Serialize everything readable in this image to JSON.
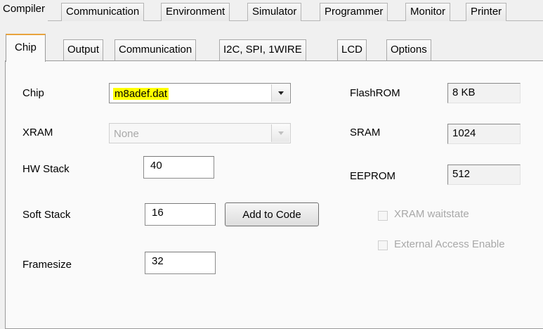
{
  "top_tabs": [
    "Compiler",
    "Communication",
    "Environment",
    "Simulator",
    "Programmer",
    "Monitor",
    "Printer"
  ],
  "sub_tabs": [
    "Chip",
    "Output",
    "Communication",
    "I2C, SPI, 1WIRE",
    "LCD",
    "Options"
  ],
  "chip": {
    "chip_label": "Chip",
    "chip_value": "m8adef.dat",
    "xram_label": "XRAM",
    "xram_value": "None",
    "hw_stack_label": "HW Stack",
    "hw_stack_value": "40",
    "soft_stack_label": "Soft Stack",
    "soft_stack_value": "16",
    "add_to_code_label": "Add to Code",
    "framesize_label": "Framesize",
    "framesize_value": "32",
    "flashrom_label": "FlashROM",
    "flashrom_value": "8 KB",
    "sram_label": "SRAM",
    "sram_value": "1024",
    "eeprom_label": "EEPROM",
    "eeprom_value": "512",
    "xram_waitstate_label": "XRAM waitstate",
    "external_access_label": "External Access Enable"
  },
  "colors": {
    "active_tab_accent": "#e8a33d",
    "highlight": "#ffff00"
  }
}
